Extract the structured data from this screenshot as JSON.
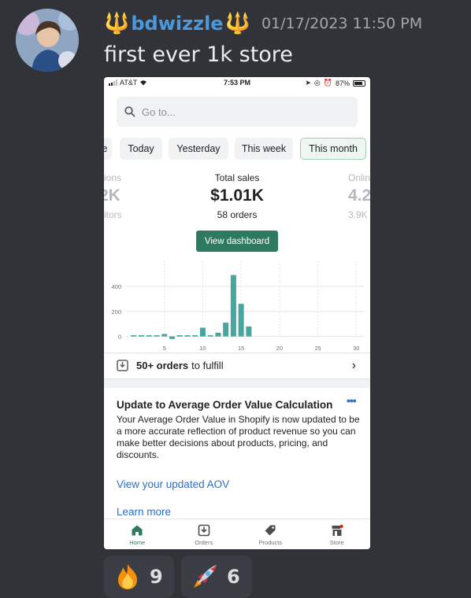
{
  "message": {
    "username": "bdwizzle",
    "decoration_left": "🔱",
    "decoration_right": "🔱",
    "timestamp": "01/17/2023 11:50 PM",
    "text": "first ever 1k store"
  },
  "screenshot": {
    "status_bar": {
      "carrier": "AT&T",
      "time": "7:53 PM",
      "battery": "87%"
    },
    "search": {
      "placeholder": "Go to..."
    },
    "date_chips": [
      {
        "label": "e"
      },
      {
        "label": "Today"
      },
      {
        "label": "Yesterday"
      },
      {
        "label": "This week"
      },
      {
        "label": "This month",
        "active": true
      }
    ],
    "metrics": {
      "left": {
        "label": "sions",
        "value": "2K",
        "sub": "sitors"
      },
      "center": {
        "label": "Total sales",
        "value": "$1.01K",
        "sub": "58 orders"
      },
      "right": {
        "label": "Onlin",
        "value": "4.2",
        "sub": "3.9K"
      }
    },
    "dashboard_button": "View dashboard",
    "chart_data": {
      "type": "bar",
      "x": [
        1,
        2,
        3,
        4,
        5,
        6,
        7,
        8,
        9,
        10,
        11,
        12,
        13,
        14,
        15,
        16,
        17
      ],
      "values": [
        10,
        10,
        10,
        10,
        20,
        -20,
        10,
        10,
        10,
        70,
        10,
        30,
        110,
        490,
        260,
        80
      ],
      "x_ticks": [
        5,
        10,
        15,
        20,
        25,
        30
      ],
      "y_ticks": [
        0,
        200,
        400
      ],
      "xlim": [
        0,
        31
      ],
      "ylim": [
        -40,
        600
      ],
      "grid": true
    },
    "orders_row": {
      "count": "50+ orders",
      "suffix": "to fulfill"
    },
    "card": {
      "title": "Update to Average Order Value Calculation",
      "menu": "•••",
      "body": "Your Average Order Value in Shopify is now updated to be a more accurate reflection of product revenue so you can make better decisions about products, pricing, and discounts.",
      "link1": "View your updated AOV",
      "link2": "Learn more"
    },
    "tabs": [
      {
        "label": "Home",
        "icon": "home-icon",
        "active": true
      },
      {
        "label": "Orders",
        "icon": "orders-icon"
      },
      {
        "label": "Products",
        "icon": "tag-icon"
      },
      {
        "label": "Store",
        "icon": "store-icon"
      }
    ]
  },
  "reactions": [
    {
      "emoji": "fire-emoji",
      "count": "9"
    },
    {
      "emoji": "rocket-emoji",
      "count": "6"
    }
  ]
}
